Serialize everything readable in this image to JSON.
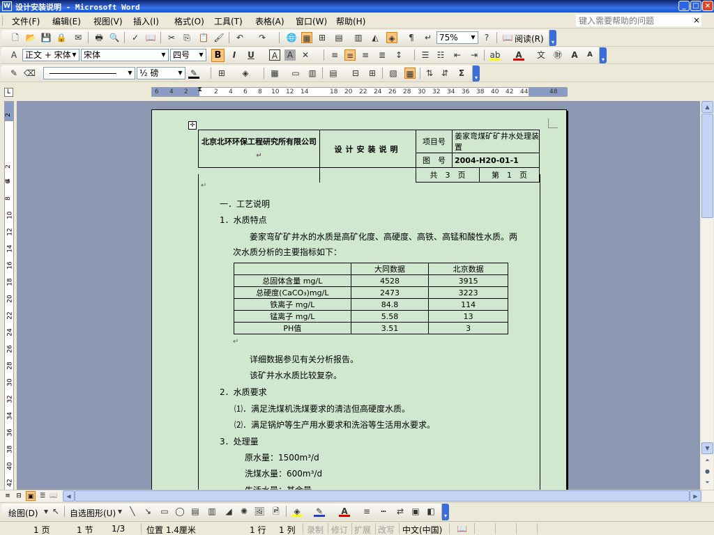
{
  "window": {
    "title": "设计安装说明 - Microsoft Word",
    "minimize": "_",
    "maximize": "□",
    "close": "×"
  },
  "menu": {
    "items": [
      "文件(F)",
      "编辑(E)",
      "视图(V)",
      "插入(I)",
      "格式(O)",
      "工具(T)",
      "表格(A)",
      "窗口(W)",
      "帮助(H)"
    ],
    "help_placeholder": "键入需要帮助的问题",
    "help_close": "×"
  },
  "toolbar_standard": {
    "zoom": "75%",
    "read_label": "阅读(R)"
  },
  "toolbar_format": {
    "style": "正文 + 宋体",
    "font": "宋体",
    "size": "四号",
    "bold": "B",
    "italic": "I",
    "underline": "U"
  },
  "toolbar_tables": {
    "line_weight": "½ 磅"
  },
  "ruler": {
    "ticks": [
      "6",
      "4",
      "2",
      "2",
      "4",
      "6",
      "8",
      "10",
      "12",
      "14",
      "18",
      "20",
      "22",
      "24",
      "26",
      "28",
      "30",
      "32",
      "34",
      "36",
      "38",
      "40",
      "42",
      "44",
      "48"
    ],
    "vticks": [
      "2",
      "2",
      "4",
      "6",
      "8",
      "10",
      "12",
      "14",
      "16",
      "18",
      "20",
      "22",
      "24",
      "26",
      "28",
      "30",
      "32",
      "34",
      "36",
      "38",
      "40",
      "42"
    ]
  },
  "document": {
    "header": {
      "company": "北京北环环保工程研究所有限公司",
      "doc_title": "设计安装说明",
      "project_label": "项目号",
      "project_value": "姜家弯煤矿矿井水处理装置",
      "drawing_label": "图　号",
      "drawing_value": "2004-H20-01-1",
      "total_pages": "共　3　页",
      "current_page": "第　1　页"
    },
    "section1": "一．工艺说明",
    "sub1": "1．水质特点",
    "para1_line1": "姜家弯矿矿井水的水质是高矿化度、高硬度、高铁、高锰和酸性水质。两",
    "para1_line2": "次水质分析的主要指标如下：",
    "water_table": {
      "headers": [
        "",
        "大同数据",
        "北京数据"
      ],
      "rows": [
        [
          "总固体含量 mg/L",
          "4528",
          "3915"
        ],
        [
          "总硬度(CaCO₃)mg/L",
          "2473",
          "3223"
        ],
        [
          "铁离子 mg/L",
          "84.8",
          "114"
        ],
        [
          "锰离子 mg/L",
          "5.58",
          "13"
        ],
        [
          "PH值",
          "3.51",
          "3"
        ]
      ]
    },
    "note1": "详细数据参见有关分析报告。",
    "note2": "该矿井水水质比较复杂。",
    "sub2": "2．水质要求",
    "req1": "⑴．满足洗煤机洗煤要求的清洁但高硬度水质。",
    "req2": "⑵．满足锅炉等生产用水要求和洗浴等生活用水要求。",
    "sub3": "3．处理量",
    "raw_water": "原水量：1500m³/d",
    "coal_water": "洗煤水量：600m³/d",
    "life_water": "生活水量：其余量"
  },
  "drawbar": {
    "draw_label": "绘图(D)",
    "autoshape_label": "自选图形(U)"
  },
  "status": {
    "page": "1 页",
    "section": "1 节",
    "pages": "1/3",
    "position": "位置 1.4厘米",
    "line": "1 行",
    "col": "1 列",
    "rec": "录制",
    "trk": "修订",
    "ext": "扩展",
    "ovr": "改写",
    "lang": "中文(中国)"
  }
}
